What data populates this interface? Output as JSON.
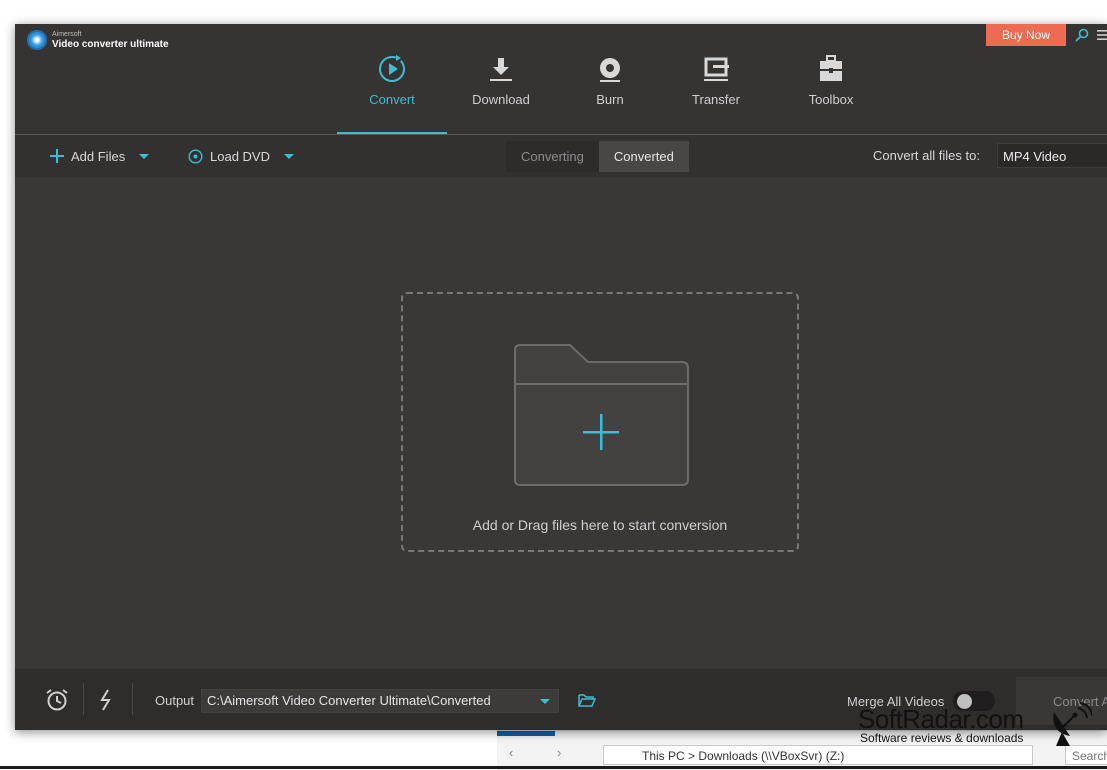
{
  "app": {
    "brand_sub": "Aimersoft",
    "brand_main": "Video converter ultimate",
    "buy_label": "Buy Now",
    "accent": "#3bbdd6",
    "buy_color": "#ef6a52"
  },
  "nav": {
    "items": [
      {
        "label": "Convert",
        "icon": "convert-icon",
        "active": true
      },
      {
        "label": "Download",
        "icon": "download-icon",
        "active": false
      },
      {
        "label": "Burn",
        "icon": "disc-icon",
        "active": false
      },
      {
        "label": "Transfer",
        "icon": "transfer-icon",
        "active": false
      },
      {
        "label": "Toolbox",
        "icon": "toolbox-icon",
        "active": false
      }
    ]
  },
  "toolbar": {
    "add_files": "Add Files",
    "load_dvd": "Load DVD",
    "tabs": [
      {
        "label": "Converting",
        "active": false
      },
      {
        "label": "Converted",
        "active": true
      }
    ],
    "convert_all_label": "Convert all files to:",
    "format_value": "MP4 Video"
  },
  "main": {
    "drop_text": "Add or Drag files here to start conversion"
  },
  "footer": {
    "output_label": "Output",
    "output_path": "C:\\Aimersoft Video Converter Ultimate\\Converted",
    "merge_label": "Merge All Videos",
    "merge_on": false,
    "convert_label": "Convert A"
  },
  "explorer": {
    "path": "This PC  >  Downloads (\\\\VBoxSvr) (Z:)",
    "nav": "‹ › ⌃",
    "search": "Search"
  },
  "watermark": {
    "title": "SoftRadar.com",
    "subtitle": "Software reviews & downloads"
  }
}
